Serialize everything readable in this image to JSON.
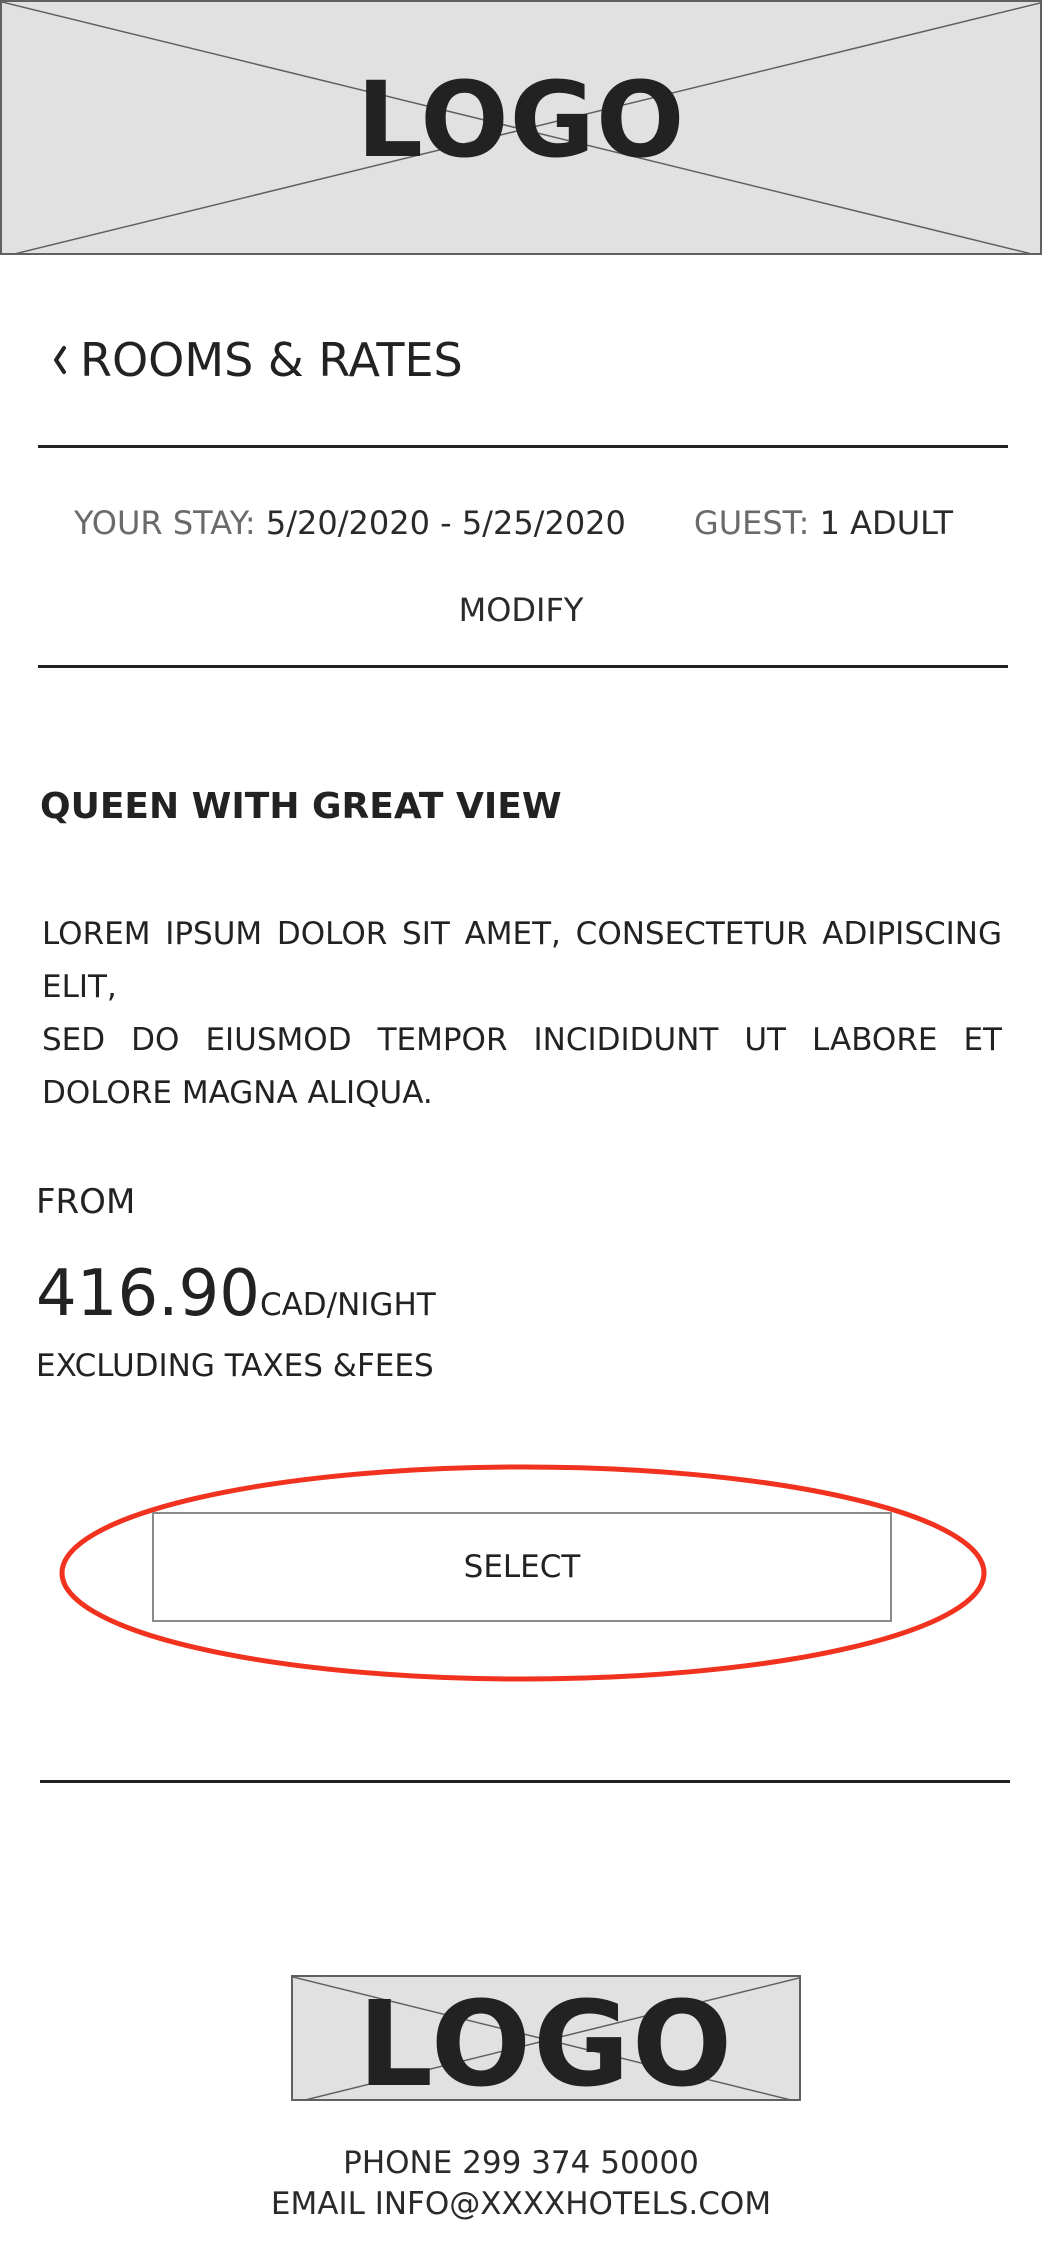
{
  "header": {
    "logo_text": "LOGO"
  },
  "nav": {
    "back_title": "ROOMS & RATES"
  },
  "stay": {
    "stay_label": "YOUR STAY: ",
    "stay_dates": "5/20/2020 - 5/25/2020",
    "guest_label": "GUEST: ",
    "guest_value": "1 ADULT",
    "modify_label": "MODIFY"
  },
  "room": {
    "title": "QUEEN WITH GREAT VIEW",
    "description_lines": [
      "LOREM IPSUM DOLOR SIT AMET, CONSECTETUR ADIPISCING ELIT,",
      "SED DO EIUSMOD TEMPOR INCIDIDUNT UT LABORE ET DOLORE MAGNA ALIQUA."
    ],
    "from_label": "FROM",
    "price": "416.90",
    "price_unit": "CAD/NIGHT",
    "tax_note": "EXCLUDING TAXES &FEES",
    "select_label": "SELECT"
  },
  "footer": {
    "logo_text": "LOGO",
    "phone": "PHONE 299 374 50000",
    "email": "EMAIL INFO@XXXXHOTELS.COM"
  },
  "colors": {
    "highlight": "#f0321e",
    "placeholder_bg": "#e1e1e1",
    "text": "#222222"
  },
  "icons": {
    "back": "chevron-left-icon"
  }
}
